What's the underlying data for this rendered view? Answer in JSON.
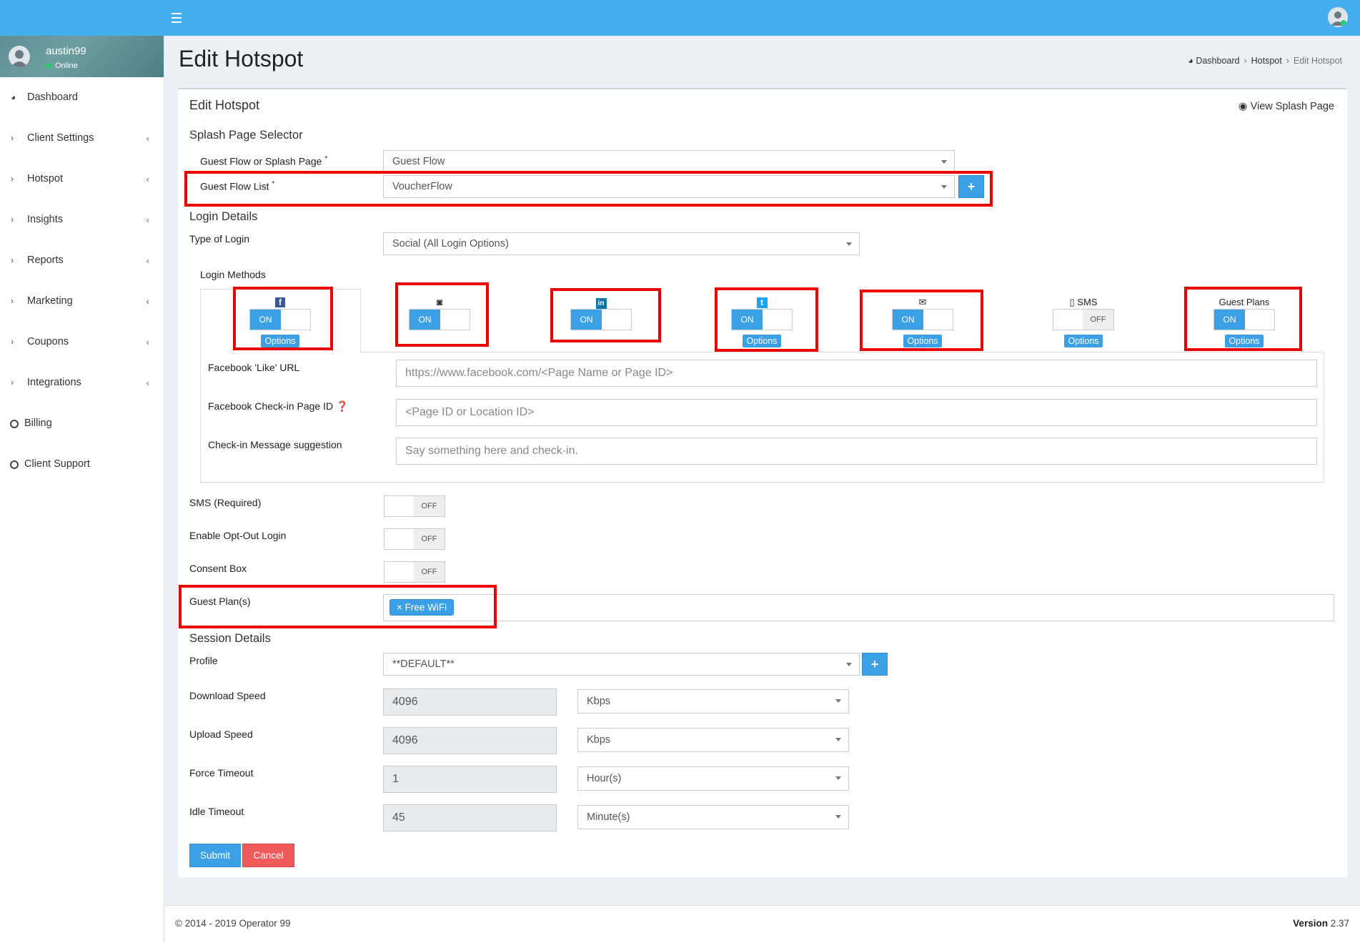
{
  "header": {
    "menu_icon": "hamburger-icon",
    "user_icon": "user-avatar-icon"
  },
  "sidebar": {
    "user": {
      "name": "austin99",
      "status": "Online"
    },
    "items": [
      {
        "label": "Dashboard",
        "icon": "dashboard-icon"
      },
      {
        "label": "Client Settings",
        "icon": "chevron-right-icon"
      },
      {
        "label": "Hotspot",
        "icon": "chevron-right-icon"
      },
      {
        "label": "Insights",
        "icon": "chevron-right-icon"
      },
      {
        "label": "Reports",
        "icon": "chevron-right-icon"
      },
      {
        "label": "Marketing",
        "icon": "chevron-right-icon"
      },
      {
        "label": "Coupons",
        "icon": "chevron-right-icon"
      },
      {
        "label": "Integrations",
        "icon": "chevron-right-icon"
      },
      {
        "label": "Billing",
        "icon": "circle-icon"
      },
      {
        "label": "Client Support",
        "icon": "circle-icon"
      }
    ]
  },
  "page": {
    "title": "Edit Hotspot"
  },
  "breadcrumb": {
    "home": "Dashboard",
    "section": "Hotspot",
    "current": "Edit Hotspot"
  },
  "form": {
    "box_title": "Edit Hotspot",
    "view_splash": "View Splash Page",
    "splash_section": "Splash Page Selector",
    "guest_flow_or_splash_label": "Guest Flow or Splash Page",
    "guest_flow_or_splash_value": "Guest Flow",
    "guest_flow_list_label": "Guest Flow List",
    "guest_flow_list_value": "VoucherFlow",
    "required_mark": "*",
    "plus": "+",
    "login_section": "Login Details",
    "type_of_login_label": "Type of Login",
    "type_of_login_value": "Social (All Login Options)",
    "login_methods_label": "Login Methods",
    "methods": [
      {
        "icon": "facebook-icon",
        "glyph": "f",
        "state": "ON",
        "options": "Options"
      },
      {
        "icon": "instagram-icon",
        "glyph": "◙",
        "state": "ON",
        "options": ""
      },
      {
        "icon": "linkedin-icon",
        "glyph": "in",
        "state": "ON",
        "options": ""
      },
      {
        "icon": "twitter-icon",
        "glyph": "t",
        "state": "ON",
        "options": "Options"
      },
      {
        "icon": "envelope-icon",
        "glyph": "✉",
        "state": "ON",
        "options": "Options"
      },
      {
        "icon": "mobile-icon",
        "label": "SMS",
        "glyph": "▯",
        "state": "OFF",
        "options": "Options"
      },
      {
        "icon": "",
        "label": "Guest Plans",
        "state": "ON",
        "options": "Options"
      }
    ],
    "fb_like_label": "Facebook 'Like' URL",
    "fb_like_placeholder": "https://www.facebook.com/<Page Name or Page ID>",
    "fb_checkin_label": "Facebook Check-in Page ID",
    "fb_checkin_placeholder": "<Page ID or Location ID>",
    "checkin_msg_label": "Check-in Message suggestion",
    "checkin_msg_placeholder": "Say something here and check-in.",
    "sms_required_label": "SMS (Required)",
    "optout_label": "Enable Opt-Out Login",
    "consent_label": "Consent Box",
    "off": "OFF",
    "guest_plans_label": "Guest Plan(s)",
    "guest_plan_tag": "× Free WiFi",
    "session_section": "Session Details",
    "profile_label": "Profile",
    "profile_value": "**DEFAULT**",
    "download_label": "Download Speed",
    "download_value": "4096",
    "download_unit": "Kbps",
    "upload_label": "Upload Speed",
    "upload_value": "4096",
    "upload_unit": "Kbps",
    "force_label": "Force Timeout",
    "force_value": "1",
    "force_unit": "Hour(s)",
    "idle_label": "Idle Timeout",
    "idle_value": "45",
    "idle_unit": "Minute(s)",
    "submit": "Submit",
    "cancel": "Cancel"
  },
  "footer": {
    "copyright": "© 2014 - 2019 Operator 99",
    "version_label": "Version",
    "version_value": "2.37"
  },
  "colors": {
    "accent": "#45aeee",
    "button": "#3ca0e6",
    "cancel": "#f05a5a",
    "highlight": "#ee0000"
  }
}
